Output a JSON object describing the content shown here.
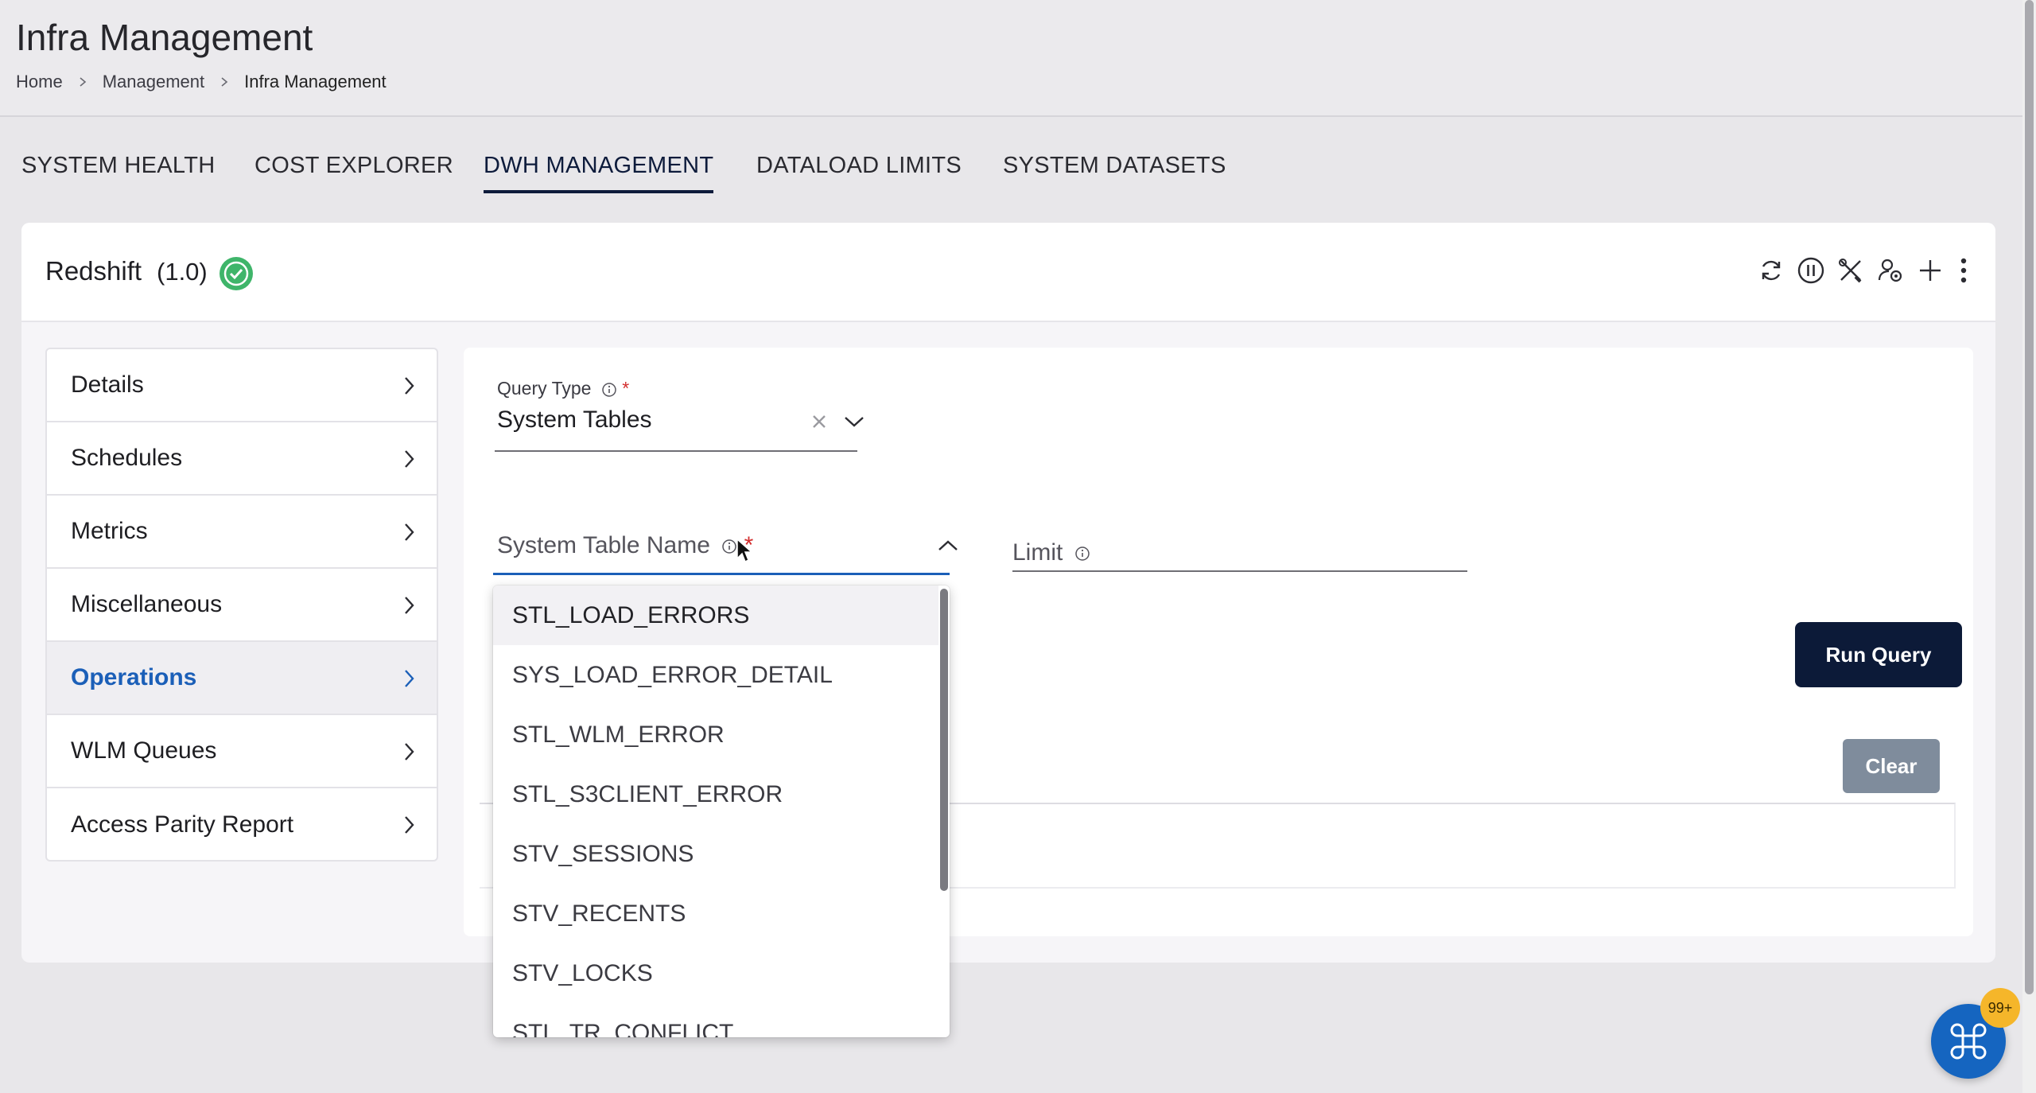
{
  "header": {
    "title": "Infra Management",
    "breadcrumb": [
      "Home",
      "Management",
      "Infra Management"
    ]
  },
  "tabs": [
    {
      "label": "SYSTEM HEALTH"
    },
    {
      "label": "COST EXPLORER"
    },
    {
      "label": "DWH MANAGEMENT",
      "active": true
    },
    {
      "label": "DATALOAD LIMITS"
    },
    {
      "label": "SYSTEM DATASETS"
    }
  ],
  "engine": {
    "name": "Redshift",
    "version": "(1.0)",
    "status_icon": "check-circle-icon",
    "status_color": "#3fb56a"
  },
  "toolbar": {
    "icons": [
      "refresh-icon",
      "pause-icon",
      "tools-icon",
      "settings-cluster-icon",
      "plus-icon",
      "more-vert-icon"
    ]
  },
  "nav": {
    "items": [
      {
        "label": "Details"
      },
      {
        "label": "Schedules"
      },
      {
        "label": "Metrics"
      },
      {
        "label": "Miscellaneous"
      },
      {
        "label": "Operations",
        "active": true
      },
      {
        "label": "WLM Queues"
      },
      {
        "label": "Access Parity Report"
      }
    ]
  },
  "form": {
    "query_type_label": "Query Type",
    "required_mark": "*",
    "query_type_value": "System Tables",
    "system_table_label": "System Table Name",
    "limit_label": "Limit",
    "run_query_label": "Run Query",
    "clear_label": "Clear"
  },
  "dropdown": {
    "options": [
      "STL_LOAD_ERRORS",
      "SYS_LOAD_ERROR_DETAIL",
      "STL_WLM_ERROR",
      "STL_S3CLIENT_ERROR",
      "STV_SESSIONS",
      "STV_RECENTS",
      "STV_LOCKS",
      "STL_TR_CONFLICT"
    ]
  },
  "fab": {
    "icon": "command-icon",
    "badge": "99+"
  },
  "colors": {
    "primary": "#0c1a38",
    "accent": "#1b5fb8",
    "required": "#d32f2f",
    "success": "#3fb56a"
  }
}
